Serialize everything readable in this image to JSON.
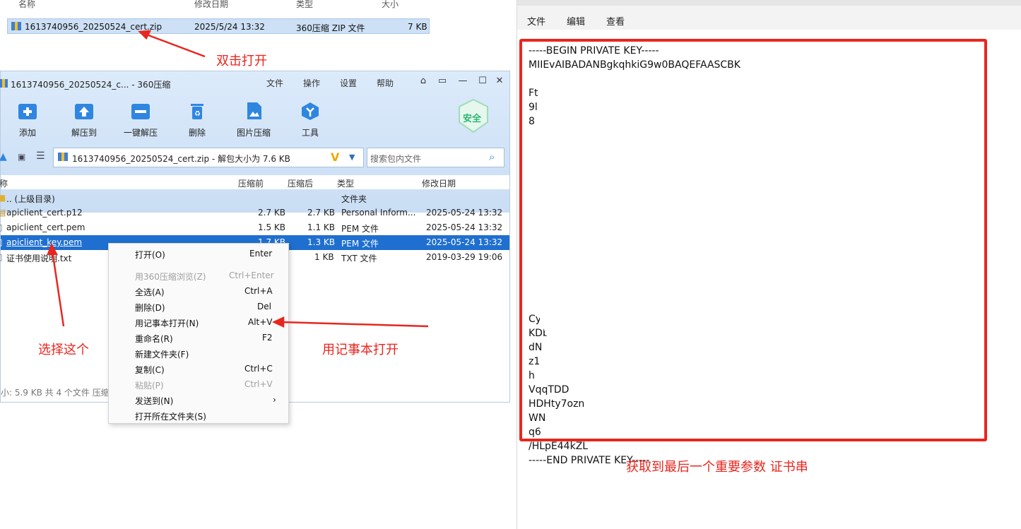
{
  "explorer": {
    "headers": [
      "名称",
      "修改日期",
      "类型",
      "大小"
    ],
    "file": {
      "name": "1613740956_20250524_cert.zip",
      "date": "2025/5/24 13:32",
      "type": "360压缩 ZIP 文件",
      "size": "7 KB"
    }
  },
  "archiver": {
    "title": "1613740956_20250524_c... - 360压缩",
    "menu": [
      "文件",
      "操作",
      "设置",
      "帮助"
    ],
    "tools": [
      "添加",
      "解压到",
      "一键解压",
      "删除",
      "图片压缩",
      "工具"
    ],
    "badge": "安全",
    "address": "1613740956_20250524_cert.zip - 解包大小为 7.6 KB",
    "search_placeholder": "搜索包内文件",
    "columns": [
      "称",
      "压缩前",
      "压缩后",
      "类型",
      "修改日期"
    ],
    "files": [
      {
        "name": ".. (上级目录)",
        "before": "",
        "after": "",
        "type": "文件夹",
        "date": ""
      },
      {
        "name": "apiclient_cert.p12",
        "before": "2.7 KB",
        "after": "2.7 KB",
        "type": "Personal Inform...",
        "date": "2025-05-24 13:32"
      },
      {
        "name": "apiclient_cert.pem",
        "before": "1.5 KB",
        "after": "1.1 KB",
        "type": "PEM 文件",
        "date": "2025-05-24 13:32"
      },
      {
        "name": "apiclient_key.pem",
        "before": "1.7 KB",
        "after": "1.3 KB",
        "type": "PEM 文件",
        "date": "2025-05-24 13:32"
      },
      {
        "name": "证书使用说明.txt",
        "before": "",
        "after": "1 KB",
        "type": "TXT 文件",
        "date": "2019-03-29 19:06"
      }
    ],
    "status": "小: 5.9 KB 共 4 个文件 压缩"
  },
  "context_menu": [
    {
      "label": "打开(O)",
      "shortcut": "Enter",
      "disabled": false
    },
    {
      "label": "用360压缩浏览(Z)",
      "shortcut": "Ctrl+Enter",
      "disabled": true
    },
    {
      "label": "全选(A)",
      "shortcut": "Ctrl+A",
      "disabled": false
    },
    {
      "label": "删除(D)",
      "shortcut": "Del",
      "disabled": false
    },
    {
      "label": "用记事本打开(N)",
      "shortcut": "Alt+V",
      "disabled": false
    },
    {
      "label": "重命名(R)",
      "shortcut": "F2",
      "disabled": false
    },
    {
      "label": "新建文件夹(F)",
      "shortcut": "",
      "disabled": false
    },
    {
      "label": "复制(C)",
      "shortcut": "Ctrl+C",
      "disabled": false
    },
    {
      "label": "粘贴(P)",
      "shortcut": "Ctrl+V",
      "disabled": true
    },
    {
      "label": "发送到(N)",
      "shortcut": "",
      "disabled": false
    },
    {
      "label": "打开所在文件夹(S)",
      "shortcut": "",
      "disabled": false
    }
  ],
  "notepad": {
    "menu": [
      "文件",
      "编辑",
      "查看"
    ],
    "lines": [
      "-----BEGIN PRIVATE KEY-----",
      "MIIEvAIBADANBgkqhkiG9w0BAQEFAASCBK",
      "",
      "Ft",
      "9l",
      "8",
      "",
      "",
      "",
      "",
      "",
      "",
      "",
      "",
      "",
      "",
      "",
      "",
      "",
      "CyCq",
      "KDbi",
      "dN",
      "z1",
      "h",
      "VqqTDD",
      "HDHty7ozn",
      "WN",
      "q6",
      "/HLpE44kZL",
      "-----END PRIVATE KEY-----"
    ]
  },
  "annotations": {
    "double_click": "双击打开",
    "choose_this": "选择这个",
    "open_notepad": "用记事本打开",
    "result": "获取到最后一个重要参数 证书串"
  },
  "colors": {
    "accent": "#e8261f",
    "selection": "#1f6fd0"
  }
}
